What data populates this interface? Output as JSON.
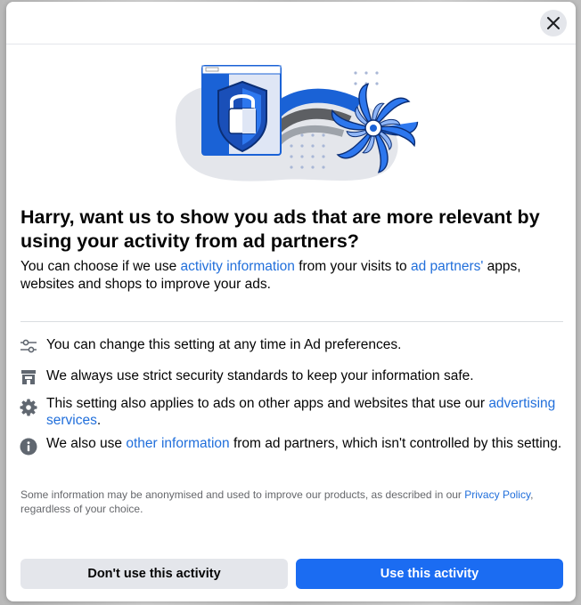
{
  "dialog": {
    "close_label": "Close",
    "title": "Harry, want us to show you ads that are more relevant by using your activity from ad partners?",
    "subtitle": {
      "part1": "You can choose if we use ",
      "link1": "activity information",
      "part2": " from your visits to ",
      "link2": "ad partners'",
      "part3": " apps, websites and shops to improve your ads."
    },
    "info_rows": [
      {
        "icon": "sliders-icon",
        "text": "You can change this setting at any time in Ad preferences."
      },
      {
        "icon": "store-icon",
        "text": "We always use strict security standards to keep your information safe."
      },
      {
        "icon": "gear-icon",
        "text_before": "This setting also applies to ads on other apps and websites that use our ",
        "link": "advertising services",
        "text_after": "."
      },
      {
        "icon": "info-icon",
        "text_before": "We also use ",
        "link": "other information",
        "text_after": " from ad partners, which isn't controlled by this setting."
      }
    ],
    "footnote": {
      "text_before": "Some information may be anonymised and used to improve our products, as described in our ",
      "link": "Privacy Policy",
      "text_after": ", regardless of your choice."
    },
    "buttons": {
      "secondary": "Don't use this activity",
      "primary": "Use this activity"
    }
  },
  "colors": {
    "link": "#216fdb",
    "primary_button": "#1b6cf2",
    "secondary_button": "#e4e6eb"
  }
}
